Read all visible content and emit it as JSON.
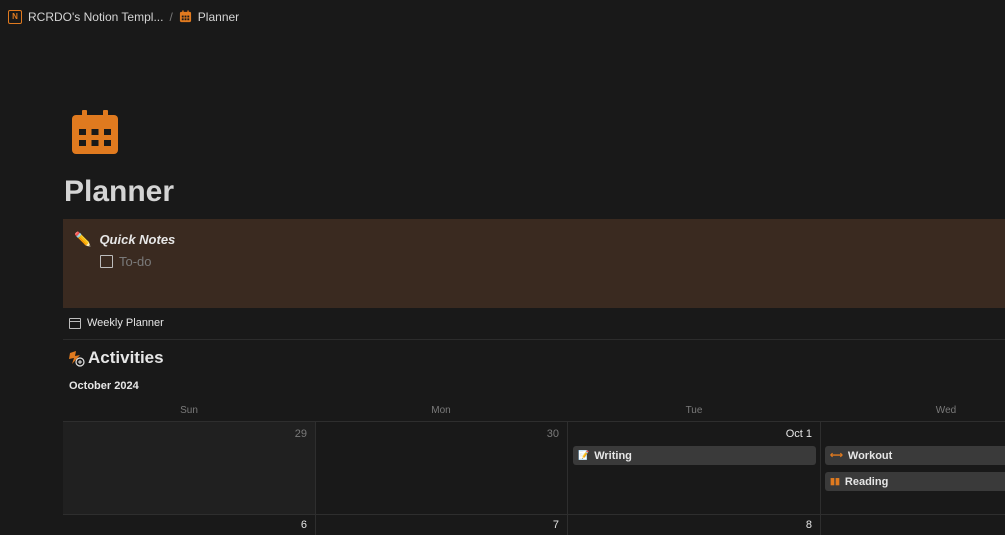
{
  "breadcrumb": {
    "workspace": "RCRDO's Notion Templ...",
    "separator": "/",
    "page": "Planner"
  },
  "page": {
    "title": "Planner"
  },
  "callout": {
    "title": "Quick Notes",
    "todo_placeholder": "To-do"
  },
  "weekly_planner": {
    "label": "Weekly Planner"
  },
  "activities": {
    "heading": "Activities",
    "month": "October 2024",
    "weekdays": [
      "Sun",
      "Mon",
      "Tue",
      "Wed"
    ],
    "week1": {
      "days": [
        "29",
        "30",
        "Oct 1",
        ""
      ],
      "events": {
        "tue": [
          {
            "label": "Writing",
            "icon": "memo-icon"
          }
        ],
        "wed": [
          {
            "label": "Workout",
            "icon": "dumbbell-icon"
          },
          {
            "label": "Reading",
            "icon": "book-icon"
          }
        ]
      }
    },
    "week2": {
      "days": [
        "6",
        "7",
        "8",
        ""
      ]
    }
  },
  "colors": {
    "background": "#191919",
    "callout_bg": "#3a2a20",
    "accent": "#e07a1f",
    "card_bg": "#3a3a3a"
  }
}
